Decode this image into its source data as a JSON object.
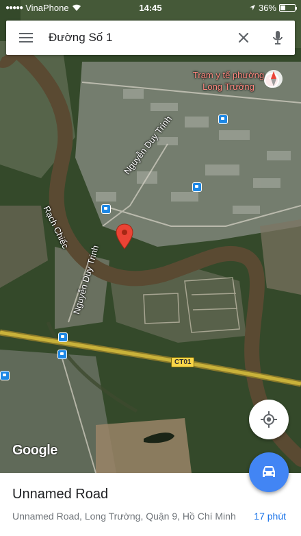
{
  "status_bar": {
    "carrier": "VinaPhone",
    "time": "14:45",
    "battery": "36%",
    "battery_level": 0.36
  },
  "search": {
    "query": "Đường Số 1",
    "menu_icon": "hamburger-menu-icon",
    "clear_icon": "close-icon",
    "mic_icon": "microphone-icon"
  },
  "map": {
    "poi": "Trạm y tế phường Long Trường",
    "roads": {
      "nguyen_duy_trinh_1": "Nguyễn Duy Trinh",
      "nguyen_duy_trinh_2": "Nguyễn Duy Trinh",
      "river": "Rạch Chiếc"
    },
    "highway_shield": "CT01",
    "attribution": "Google",
    "colors": {
      "river": "#5a4a32",
      "vegetation": "#2f4a22",
      "highway": "#c9b23a",
      "marker": "#ea4335"
    }
  },
  "controls": {
    "locate_icon": "my-location-icon",
    "directions_icon": "car-icon"
  },
  "place": {
    "title": "Unnamed Road",
    "address": "Unnamed Road, Long Trường, Quận 9, Hồ Chí Minh",
    "travel_time": "17 phút"
  }
}
